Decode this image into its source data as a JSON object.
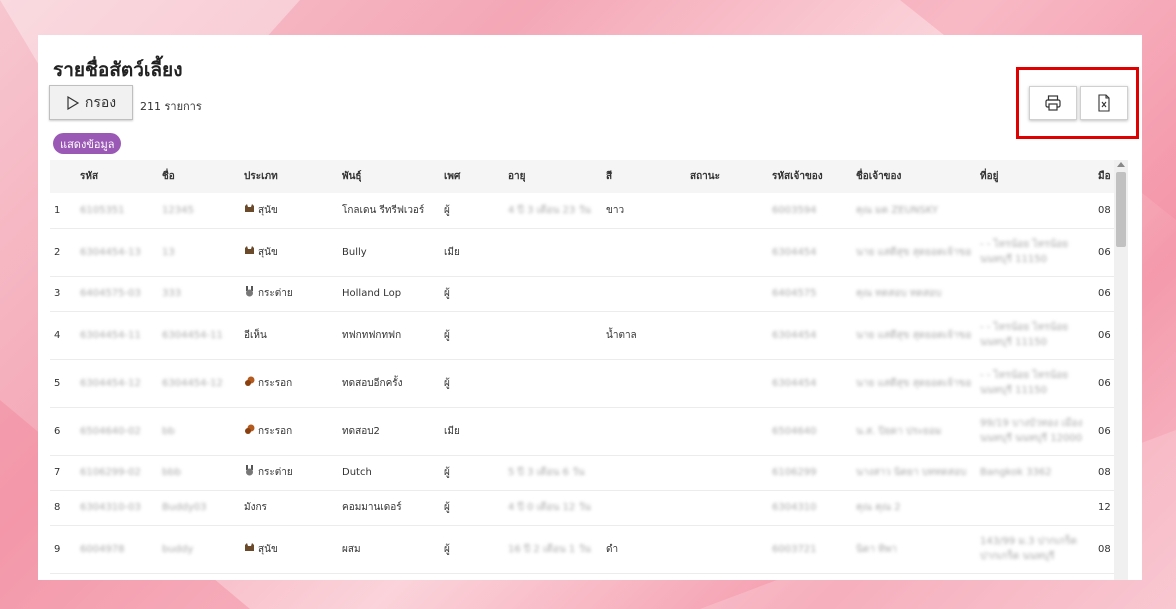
{
  "page": {
    "title": "รายชื่อสัตว์เลี้ยง",
    "filter_label": "กรอง",
    "count_text": "211 รายการ",
    "show_data_label": "แสดงข้อมูล"
  },
  "toolbar": {
    "print_icon": "printer-icon",
    "excel_icon": "excel-export-icon",
    "highlight_color": "#e00000"
  },
  "table": {
    "columns": [
      "รหัส",
      "ชื่อ",
      "ประเภท",
      "พันธุ์",
      "เพศ",
      "อายุ",
      "สี",
      "สถานะ",
      "รหัสเจ้าของ",
      "ชื่อเจ้าของ",
      "ที่อยู่",
      "มือ"
    ],
    "rows": [
      {
        "no": "1",
        "code": "6105351",
        "name": "12345",
        "type": "สุนัข",
        "type_icon": "dog",
        "breed": "โกลเดน รีทรีฟเวอร์",
        "sex": "ผู้",
        "age": "4 ปี 3 เดือน 23 วัน",
        "color": "ขาว",
        "status": "",
        "owner_code": "6003594",
        "owner_name": "คุณ มด ZEUNSKY",
        "address": "",
        "phone": "08"
      },
      {
        "no": "2",
        "code": "6304454-13",
        "name": "13",
        "type": "สุนัข",
        "type_icon": "dog",
        "breed": "Bully",
        "sex": "เมีย",
        "age": "",
        "color": "",
        "status": "",
        "owner_code": "6304454",
        "owner_name": "นาย แสดีสุข สุดยอดเจ้าขอ",
        "address": "- - ไทรน้อย ไทรน้อย นนทบุรี 11150",
        "phone": "06"
      },
      {
        "no": "3",
        "code": "6404575-03",
        "name": "333",
        "type": "กระต่าย",
        "type_icon": "rabbit",
        "breed": "Holland Lop",
        "sex": "ผู้",
        "age": "",
        "color": "",
        "status": "",
        "owner_code": "6404575",
        "owner_name": "คุณ ทดสอบ ทดสอบ",
        "address": "",
        "phone": "06"
      },
      {
        "no": "4",
        "code": "6304454-11",
        "name": "6304454-11",
        "type": "อีเห็น",
        "type_icon": "",
        "breed": "ทฟกทฟกทฟก",
        "sex": "ผู้",
        "age": "",
        "color": "น้ำตาล",
        "status": "",
        "owner_code": "6304454",
        "owner_name": "นาย แสดีสุข สุดยอดเจ้าขอ",
        "address": "- - ไทรน้อย ไทรน้อย นนทบุรี 11150",
        "phone": "06"
      },
      {
        "no": "5",
        "code": "6304454-12",
        "name": "6304454-12",
        "type": "กระรอก",
        "type_icon": "squirrel",
        "breed": "ทดสอบอีกครั้ง",
        "sex": "ผู้",
        "age": "",
        "color": "",
        "status": "",
        "owner_code": "6304454",
        "owner_name": "นาย แสดีสุข สุดยอดเจ้าขอ",
        "address": "- - ไทรน้อย ไทรน้อย นนทบุรี 11150",
        "phone": "06"
      },
      {
        "no": "6",
        "code": "6504640-02",
        "name": "bb",
        "type": "กระรอก",
        "type_icon": "squirrel",
        "breed": "ทดสอบ2",
        "sex": "เมีย",
        "age": "",
        "color": "",
        "status": "",
        "owner_code": "6504640",
        "owner_name": "น.ส. ปิยดา ประยอม",
        "address": "99/19 บางบัวทอง เมือง นนทบุรี นนทบุรี 12000",
        "phone": "06"
      },
      {
        "no": "7",
        "code": "6106299-02",
        "name": "bbb",
        "type": "กระต่าย",
        "type_icon": "rabbit",
        "breed": "Dutch",
        "sex": "ผู้",
        "age": "5 ปี 3 เดือน 6 วัน",
        "color": "",
        "status": "",
        "owner_code": "6106299",
        "owner_name": "นางสาว นิตยา บททดสอบ",
        "address": "Bangkok 3362",
        "phone": "08"
      },
      {
        "no": "8",
        "code": "6304310-03",
        "name": "Buddy03",
        "type": "มังกร",
        "type_icon": "",
        "breed": "คอมมานเดอร์",
        "sex": "ผู้",
        "age": "4 ปี 0 เดือน 12 วัน",
        "color": "",
        "status": "",
        "owner_code": "6304310",
        "owner_name": "คุณ คุณ 2",
        "address": "",
        "phone": "12"
      },
      {
        "no": "9",
        "code": "6004978",
        "name": "buddy",
        "type": "สุนัข",
        "type_icon": "dog",
        "breed": "ผสม",
        "sex": "ผู้",
        "age": "16 ปี 2 เดือน 1 วัน",
        "color": "ดำ",
        "status": "",
        "owner_code": "6003721",
        "owner_name": "นิดา ทิพา",
        "address": "143/99 ม.3 ปากเกร็ด ปากเกร็ด นนทบุรี",
        "phone": "08"
      }
    ]
  }
}
